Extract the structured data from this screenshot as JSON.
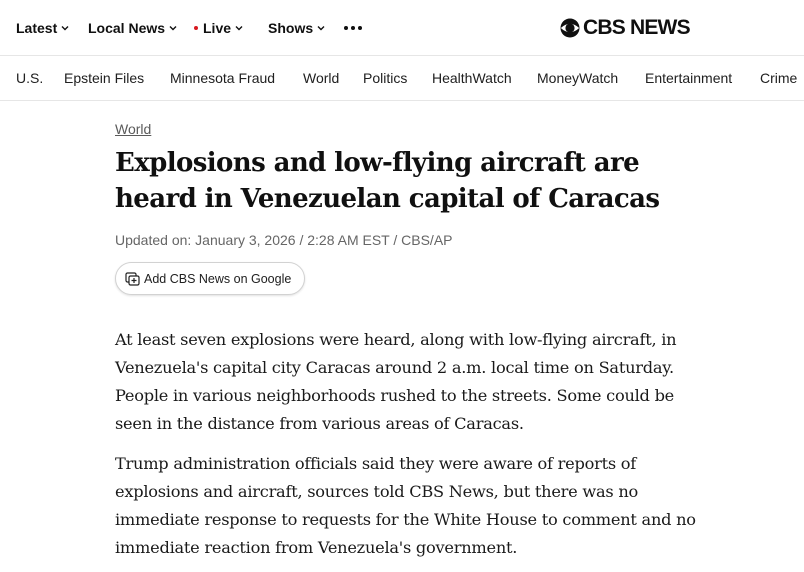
{
  "topnav": {
    "latest": "Latest",
    "local_news": "Local News",
    "live": "Live",
    "shows": "Shows"
  },
  "logo_text": "CBS NEWS",
  "sections": [
    "U.S.",
    "Epstein Files",
    "Minnesota Fraud",
    "World",
    "Politics",
    "HealthWatch",
    "MoneyWatch",
    "Entertainment",
    "Crime"
  ],
  "article": {
    "category": "World",
    "headline": "Explosions and low-flying aircraft are heard in Venezuelan capital of Caracas",
    "byline": "Updated on: January 3, 2026 / 2:28 AM EST / CBS/AP",
    "google_button": "Add CBS News on Google",
    "paragraphs": [
      "At least seven explosions were heard, along with low-flying aircraft, in Venezuela's capital city Caracas around 2 a.m. local time on Saturday. People in various neighborhoods rushed to the streets. Some could be seen in the distance from various areas of Caracas.",
      "Trump administration officials said they were aware of reports of explosions and aircraft, sources told CBS News, but there was no immediate response to requests for the White House to comment and no immediate reaction from Venezuela's government."
    ]
  },
  "colors": {
    "live_dot": "#d71920",
    "text": "#101010",
    "muted": "#666666"
  },
  "icons": {
    "dropdown": "chevron-down-icon",
    "more": "more-dots-icon",
    "logo": "cbs-eye-logo",
    "google_add": "add-source-icon"
  }
}
